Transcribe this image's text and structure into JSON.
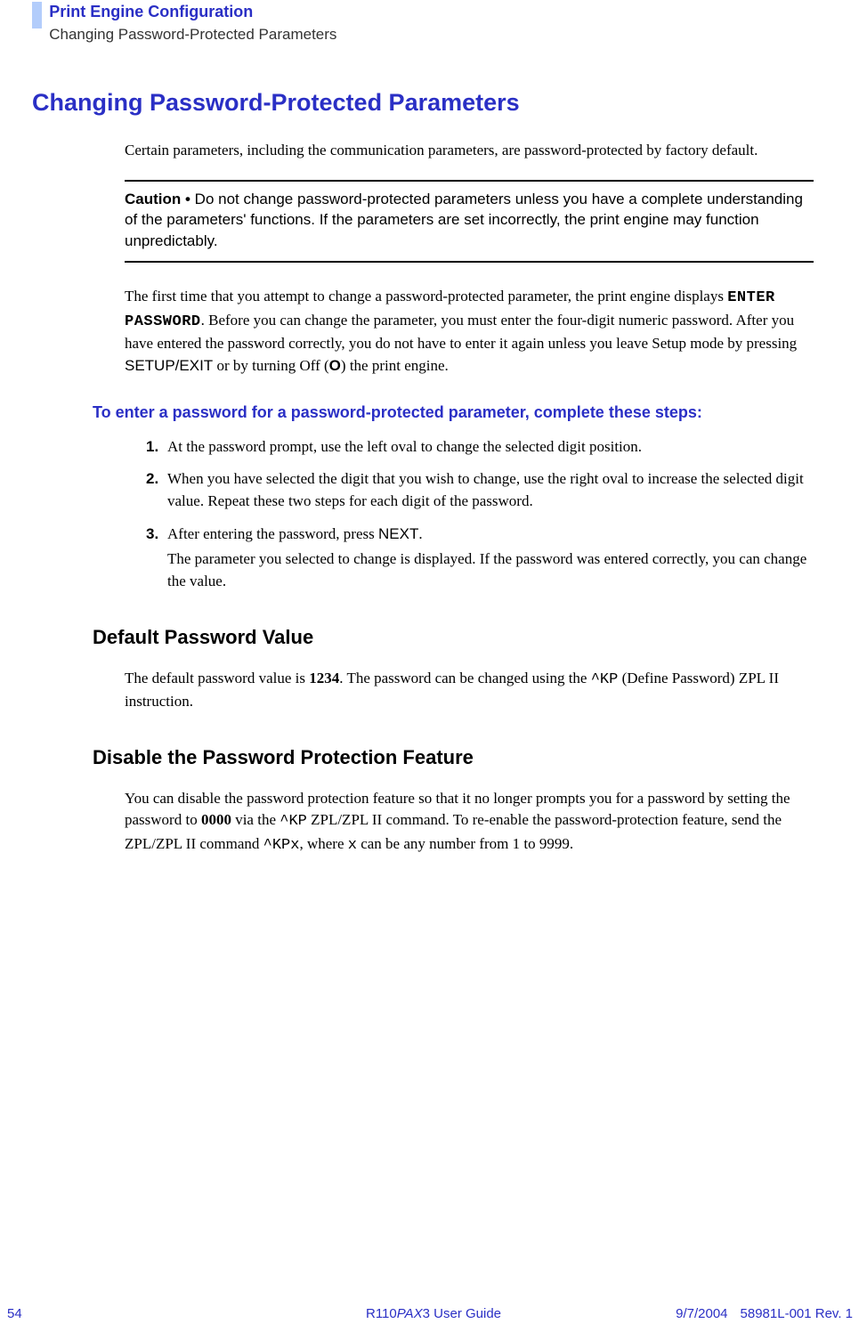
{
  "header": {
    "chapter": "Print Engine Configuration",
    "section": "Changing Password-Protected Parameters"
  },
  "title": "Changing Password-Protected Parameters",
  "intro": "Certain parameters, including the communication parameters, are password-protected by factory default.",
  "caution": {
    "label": "Caution • ",
    "text": "Do not change password-protected parameters unless you have a complete understanding of the parameters' functions. If the parameters are set incorrectly, the print engine may function unpredictably."
  },
  "para2": {
    "pre": "The first time that you attempt to change a password-protected parameter, the print engine displays ",
    "lcd": "ENTER PASSWORD",
    "mid": ". Before you can change the parameter, you must enter the four-digit numeric password. After you have entered the password correctly, you do not have to enter it again unless you leave Setup mode by pressing ",
    "btn": "SETUP/EXIT",
    "mid2": " or by turning Off (",
    "off": "O",
    "post": ") the print engine."
  },
  "steps_heading": "To enter a password for a password-protected parameter, complete these steps:",
  "steps": [
    {
      "n": "1.",
      "text": "At the password prompt, use the left oval to change the selected digit position."
    },
    {
      "n": "2.",
      "text": "When you have selected the digit that you wish to change, use the right oval to increase the selected digit value. Repeat these two steps for each digit of the password."
    },
    {
      "n": "3.",
      "pre": "After entering the password, press ",
      "btn": "NEXT",
      "post": ".",
      "extra": "The parameter you selected to change is displayed. If the password was entered correctly, you can change the value."
    }
  ],
  "default_pw": {
    "heading": "Default Password Value",
    "pre": "The default password value is ",
    "val": "1234",
    "mid": ". The password can be changed using the ",
    "cmd": "^KP",
    "post": " (Define Password) ZPL II instruction."
  },
  "disable": {
    "heading": "Disable the Password Protection Feature",
    "pre": "You can disable the password protection feature so that it no longer prompts you for a password by setting the password to ",
    "val": "0000",
    "mid": " via the ",
    "cmd1": "^KP",
    "mid2": " ZPL/ZPL II command. To re-enable the password-protection feature, send the ZPL/ZPL II command ",
    "cmd2": "^KPx",
    "mid3": ", where ",
    "var": "x",
    "post": " can be any number from 1 to 9999."
  },
  "footer": {
    "page": "54",
    "guide_pre": "R110",
    "guide_italic": "PAX",
    "guide_post": "3 User Guide",
    "date": "9/7/2004",
    "rev": "58981L-001 Rev. 1"
  }
}
